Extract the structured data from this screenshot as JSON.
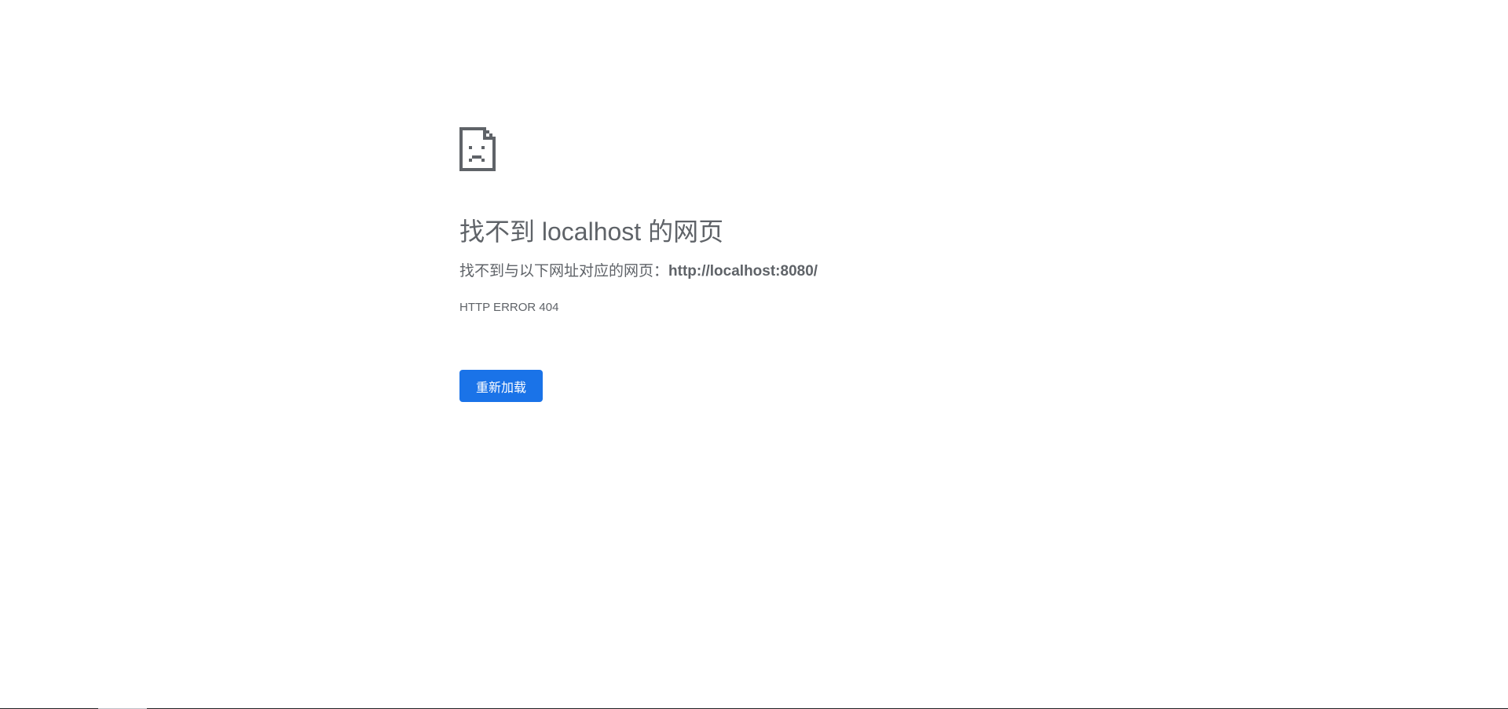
{
  "error_page": {
    "icon": "sad-document-icon",
    "title": "找不到 localhost 的网页",
    "subtitle_prefix": "找不到与以下网址对应的网页：",
    "url": "http://localhost:8080/",
    "error_code": "HTTP ERROR 404",
    "reload_label": "重新加载"
  },
  "colors": {
    "text": "#5f6368",
    "accent": "#1a73e8",
    "background": "#ffffff"
  }
}
